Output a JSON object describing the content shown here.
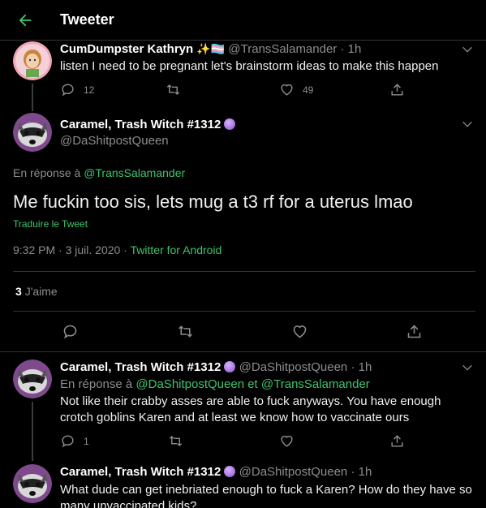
{
  "header": {
    "title": "Tweeter"
  },
  "parent_tweet": {
    "name": "CumDumpster Kathryn",
    "name_emoji": "✨🏳️‍⚧️",
    "handle": "@TransSalamander",
    "time": "· 1h",
    "text": "listen I need to be pregnant let's brainstorm ideas to make this happen",
    "replies": "12",
    "likes": "49"
  },
  "main_tweet": {
    "name": "Caramel, Trash Witch #1312",
    "handle": "@DaShitpostQueen",
    "reply_prefix": "En réponse à",
    "reply_to": "@TransSalamander",
    "text": "Me fuckin too sis, lets mug a t3 rf for a uterus lmao",
    "translate": "Traduire le Tweet",
    "timestamp": "9:32 PM · 3 juil. 2020 ·",
    "client": "Twitter for Android",
    "likes_count": "3",
    "likes_label": "J'aime"
  },
  "reply1": {
    "name": "Caramel, Trash Witch #1312",
    "handle": "@DaShitpostQueen",
    "time": "· 1h",
    "reply_prefix": "En réponse à",
    "reply_to_1": "@DaShitpostQueen",
    "reply_and": "et",
    "reply_to_2": "@TransSalamander",
    "text": "Not like their crabby asses are able to fuck anyways. You have enough crotch goblins Karen and at least we know how to vaccinate ours",
    "replies": "1"
  },
  "reply2": {
    "name": "Caramel, Trash Witch #1312",
    "handle": "@DaShitpostQueen",
    "time": "· 1h",
    "text": "What dude can get inebriated enough to fuck a Karen? How do they have so many unvaccinated kids?"
  },
  "colors": {
    "accent": "#3ec46d",
    "background": "#000000",
    "muted": "#8b8d91"
  },
  "icons": [
    "back-arrow-icon",
    "reply-icon",
    "retweet-icon",
    "like-icon",
    "share-icon",
    "chevron-down-icon",
    "crystal-ball-icon"
  ]
}
